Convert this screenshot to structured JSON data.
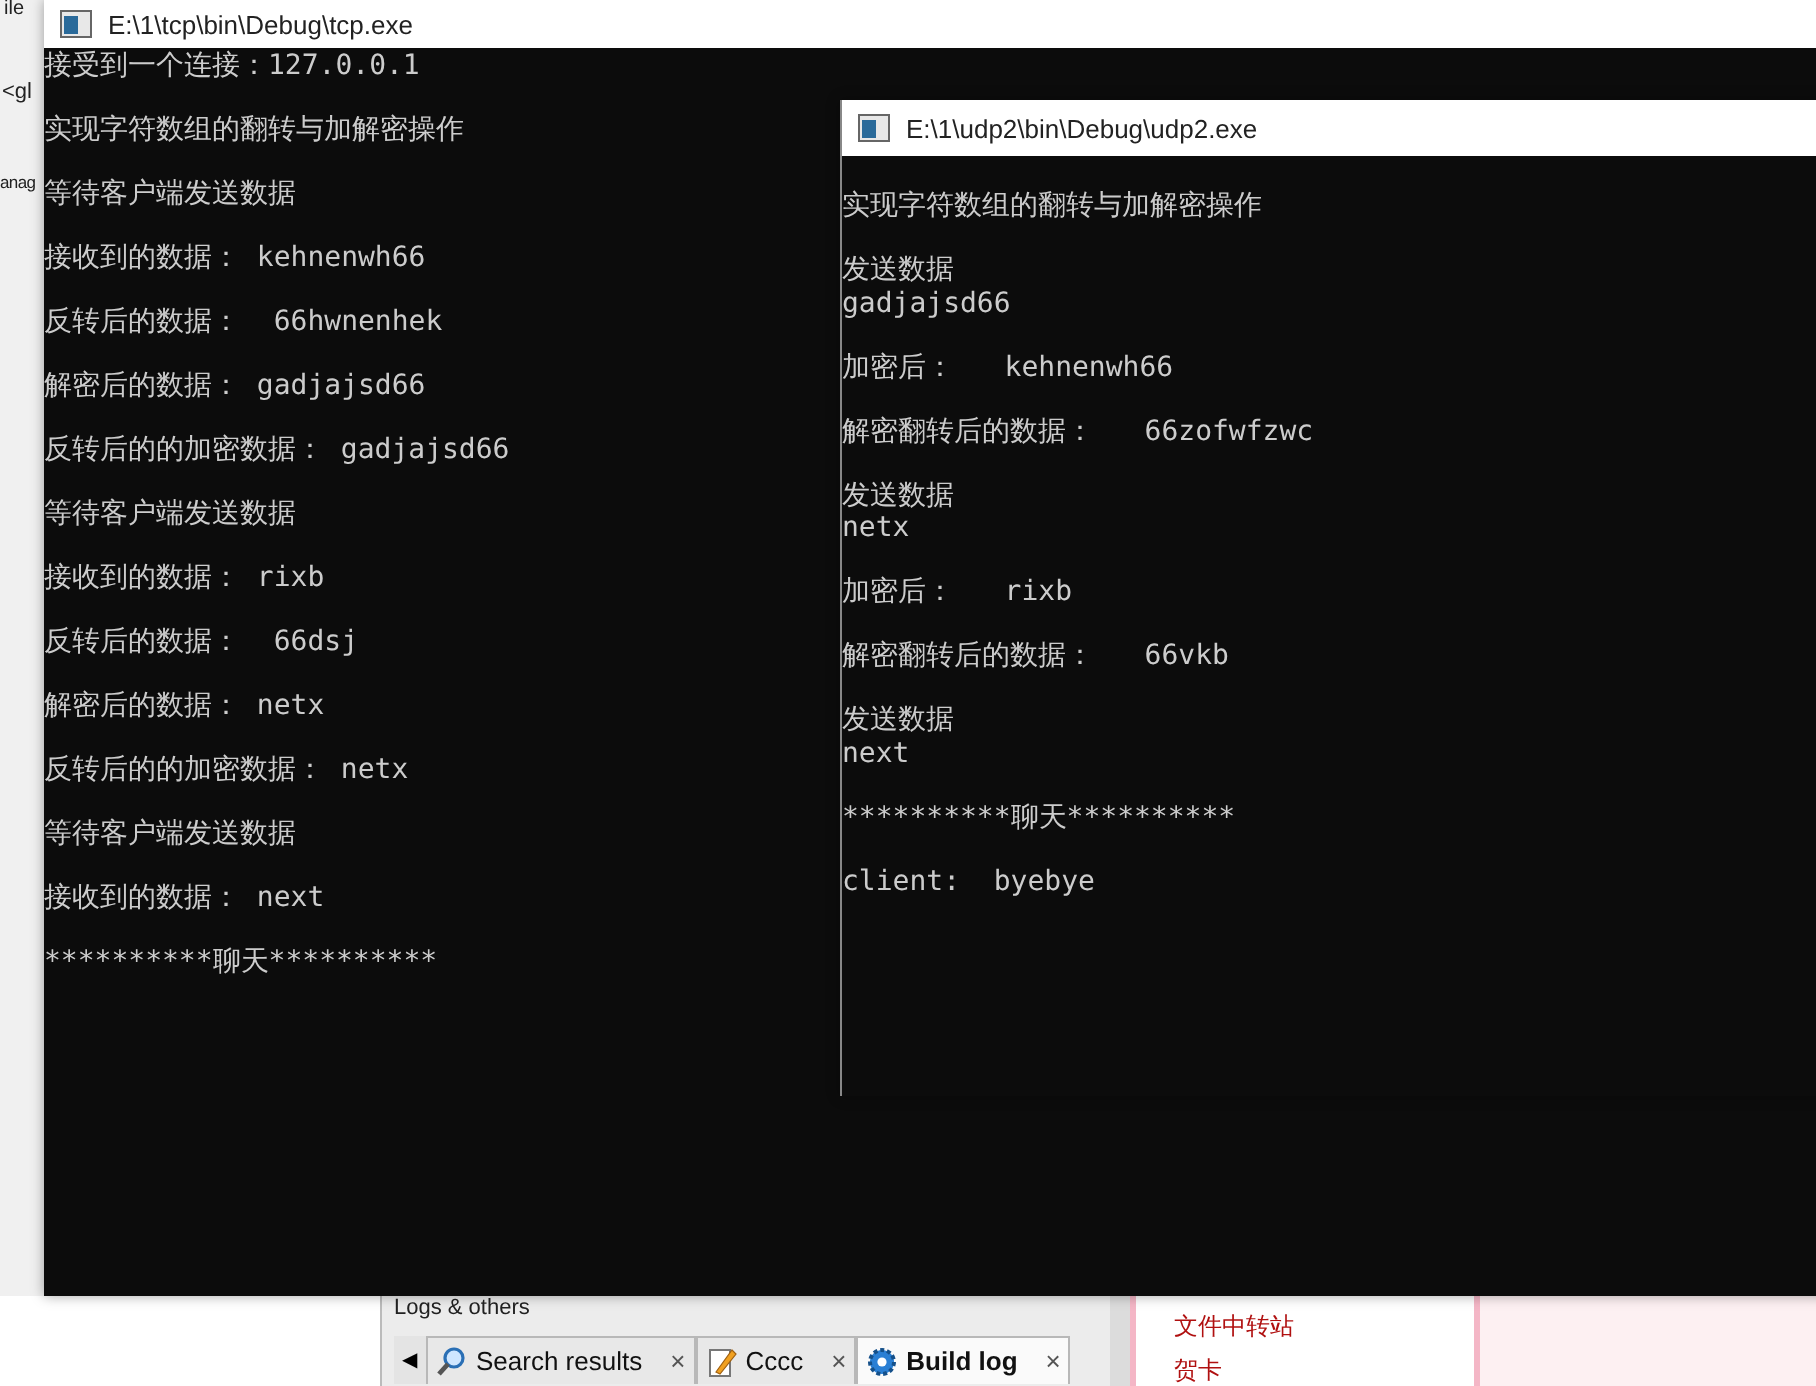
{
  "ide_sidebar": {
    "fragments": [
      "ile",
      "<gl",
      "anag"
    ]
  },
  "logs_panel": {
    "title": "Logs & others",
    "scroll_left": "◀",
    "tabs": [
      {
        "label": "Search results",
        "selected": false,
        "close": "×"
      },
      {
        "label": "Cccc",
        "selected": false,
        "close": "×"
      },
      {
        "label": "Build log",
        "selected": true,
        "close": "×"
      }
    ]
  },
  "browser_panel": {
    "links": [
      "文件中转站",
      "贺卡"
    ]
  },
  "windows": [
    {
      "title": "E:\\1\\tcp\\bin\\Debug\\tcp.exe",
      "blocks": [
        [
          "接受到一个连接：127.0.0.1"
        ],
        [
          "实现字符数组的翻转与加解密操作"
        ],
        [
          "等待客户端发送数据"
        ],
        [
          "接收到的数据： kehnenwh66"
        ],
        [
          "反转后的数据：  66hwnenhek"
        ],
        [
          "解密后的数据： gadjajsd66"
        ],
        [
          "反转后的的加密数据： gadjajsd66"
        ],
        [
          "等待客户端发送数据"
        ],
        [
          "接收到的数据： rixb"
        ],
        [
          "反转后的数据：  66dsj"
        ],
        [
          "解密后的数据： netx"
        ],
        [
          "反转后的的加密数据： netx"
        ],
        [
          "等待客户端发送数据"
        ],
        [
          "接收到的数据： next"
        ],
        [
          "**********聊天**********"
        ]
      ]
    },
    {
      "title": "E:\\1\\udp2\\bin\\Debug\\udp2.exe",
      "blocks": [
        [
          "实现字符数组的翻转与加解密操作"
        ],
        [
          "发送数据",
          "gadjajsd66"
        ],
        [
          "加密后：   kehnenwh66"
        ],
        [
          "解密翻转后的数据：   66zofwfzwc"
        ],
        [
          "发送数据",
          "netx"
        ],
        [
          "加密后：   rixb"
        ],
        [
          "解密翻转后的数据：   66vkb"
        ],
        [
          "发送数据",
          "next"
        ],
        [
          "**********聊天**********"
        ],
        [
          "client:  byebye"
        ]
      ]
    }
  ]
}
